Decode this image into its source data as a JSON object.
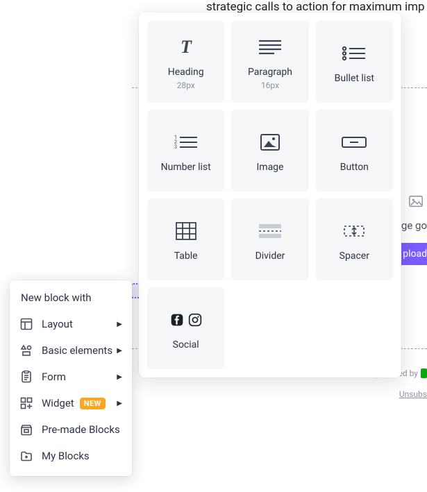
{
  "background": {
    "partial_text": "strategic calls to action for maximum imp",
    "image_caption_fragment": "age go",
    "upload_fragment": "pload",
    "powered_by": "powered by",
    "unsubscribe_fragment": "Unsubs"
  },
  "elements_panel": {
    "tiles": [
      {
        "name": "heading",
        "label": "Heading",
        "sub": "28px"
      },
      {
        "name": "paragraph",
        "label": "Paragraph",
        "sub": "16px"
      },
      {
        "name": "bulletlist",
        "label": "Bullet list",
        "sub": ""
      },
      {
        "name": "numberlist",
        "label": "Number list",
        "sub": ""
      },
      {
        "name": "image",
        "label": "Image",
        "sub": ""
      },
      {
        "name": "button",
        "label": "Button",
        "sub": ""
      },
      {
        "name": "table",
        "label": "Table",
        "sub": ""
      },
      {
        "name": "divider",
        "label": "Divider",
        "sub": ""
      },
      {
        "name": "spacer",
        "label": "Spacer",
        "sub": ""
      },
      {
        "name": "social",
        "label": "Social",
        "sub": ""
      }
    ]
  },
  "side_menu": {
    "title": "New block with",
    "items": [
      {
        "label": "Layout",
        "has_sub": true,
        "badge": ""
      },
      {
        "label": "Basic elements",
        "has_sub": true,
        "badge": ""
      },
      {
        "label": "Form",
        "has_sub": true,
        "badge": ""
      },
      {
        "label": "Widget",
        "has_sub": true,
        "badge": "NEW"
      },
      {
        "label": "Pre-made Blocks",
        "has_sub": false,
        "badge": ""
      },
      {
        "label": "My Blocks",
        "has_sub": false,
        "badge": ""
      }
    ]
  }
}
